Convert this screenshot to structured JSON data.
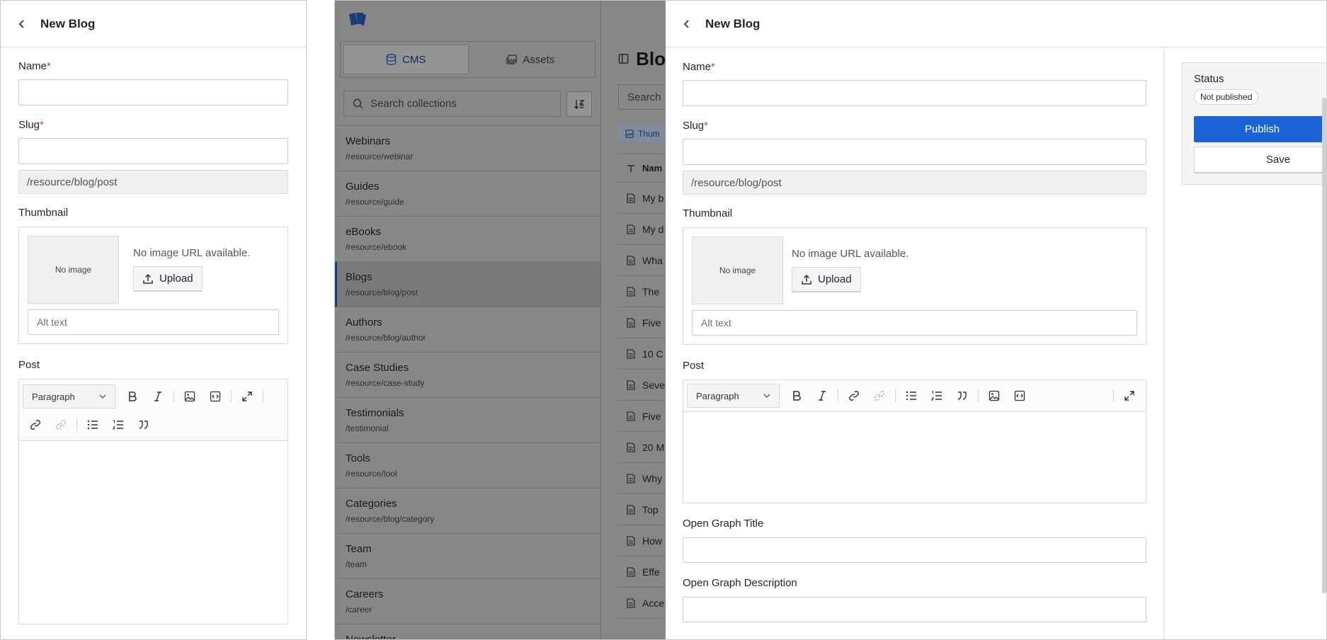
{
  "left_panel": {
    "title": "New Blog",
    "name_label": "Name",
    "slug_label": "Slug",
    "slug_path": "/resource/blog/post",
    "thumbnail_label": "Thumbnail",
    "no_image": "No image",
    "no_image_url": "No image URL available.",
    "upload_label": "Upload",
    "alt_placeholder": "Alt text",
    "post_label": "Post",
    "paragraph_label": "Paragraph"
  },
  "cms": {
    "tabs": [
      {
        "label": "CMS",
        "icon": "database-icon",
        "active": true
      },
      {
        "label": "Assets",
        "icon": "images-icon",
        "active": false
      }
    ],
    "search_placeholder": "Search collections",
    "collections": [
      {
        "name": "Webinars",
        "path": "/resource/webinar"
      },
      {
        "name": "Guides",
        "path": "/resource/guide"
      },
      {
        "name": "eBooks",
        "path": "/resource/ebook"
      },
      {
        "name": "Blogs",
        "path": "/resource/blog/post",
        "selected": true
      },
      {
        "name": "Authors",
        "path": "/resource/blog/author"
      },
      {
        "name": "Case Studies",
        "path": "/resource/case-study"
      },
      {
        "name": "Testimonials",
        "path": "/testimonial"
      },
      {
        "name": "Tools",
        "path": "/resource/tool"
      },
      {
        "name": "Categories",
        "path": "/resource/blog/category"
      },
      {
        "name": "Team",
        "path": "/team"
      },
      {
        "name": "Careers",
        "path": "/career"
      },
      {
        "name": "Newsletter",
        "path": ""
      }
    ]
  },
  "list": {
    "title": "Blo",
    "search": "Search",
    "filter_chip": "Thum",
    "column_header": "Nam",
    "rows": [
      "My b",
      "My d",
      "Wha",
      "The",
      "Five",
      "10 C",
      "Seve",
      "Five",
      "20 M",
      "Why",
      "Top",
      "How",
      "Effe",
      "Acce"
    ]
  },
  "right_panel": {
    "title": "New Blog",
    "name_label": "Name",
    "slug_label": "Slug",
    "slug_path": "/resource/blog/post",
    "thumbnail_label": "Thumbnail",
    "no_image": "No image",
    "no_image_url": "No image URL available.",
    "upload_label": "Upload",
    "alt_placeholder": "Alt text",
    "post_label": "Post",
    "paragraph_label": "Paragraph",
    "og_title_label": "Open Graph Title",
    "og_desc_label": "Open Graph Description"
  },
  "status": {
    "label": "Status",
    "badge": "Not published",
    "publish": "Publish",
    "save": "Save"
  },
  "colors": {
    "accent": "#1d63d8",
    "required": "#e5393b",
    "overlay": "#878787"
  }
}
